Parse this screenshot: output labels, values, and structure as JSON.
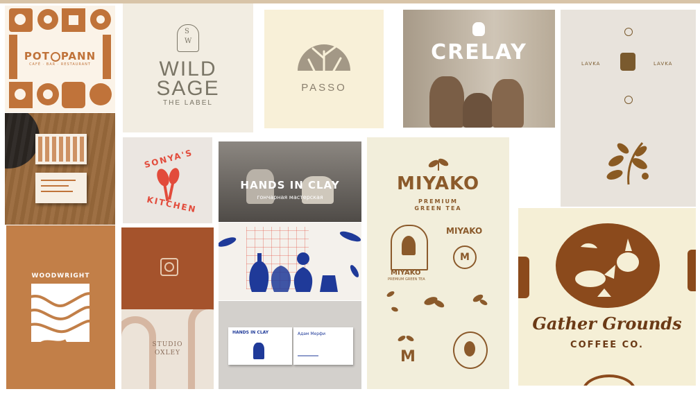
{
  "colors": {
    "terracotta": "#c0733a",
    "rust": "#a8502a",
    "olive_brown": "#8a6f47",
    "cream": "#f2eedb",
    "navy": "#1f3a99",
    "brown": "#8b5a2b",
    "red": "#e24b3b"
  },
  "tiles": {
    "potpann": {
      "brand": "POT",
      "brand2": "PANN",
      "tagline": "CAFÉ · BAR · RESTAURANT"
    },
    "wildsage": {
      "monogram_s": "S",
      "monogram_w": "W",
      "line1": "WILD",
      "line2": "SAGE",
      "line3": "THE LABEL"
    },
    "passo": {
      "name": "PASSO"
    },
    "crelay": {
      "name": "CRELAY"
    },
    "lavka": {
      "name": "LAVKA"
    },
    "sonyas": {
      "line1": "SONYA'S",
      "line2": "KITCHEN"
    },
    "handsinclay": {
      "title": "HANDS IN CLAY",
      "subtitle": "гончарная мастерская",
      "card_name": "Адам Мерфи",
      "card_title": "HANDS IN CLAY"
    },
    "miyako": {
      "name": "MIYAKO",
      "tagline1": "PREMIUM",
      "tagline2": "GREEN TEA",
      "badge_name": "MIYAKO",
      "badge_tag": "PREMIUM GREEN TEA",
      "side_name": "MIYAKO",
      "letter": "M"
    },
    "woodwright": {
      "name": "WOODWRIGHT"
    },
    "oxley": {
      "line1": "STUDIO",
      "line2": "OXLEY"
    },
    "gather": {
      "script": "Gather Grounds",
      "sub": "COFFEE CO."
    }
  }
}
